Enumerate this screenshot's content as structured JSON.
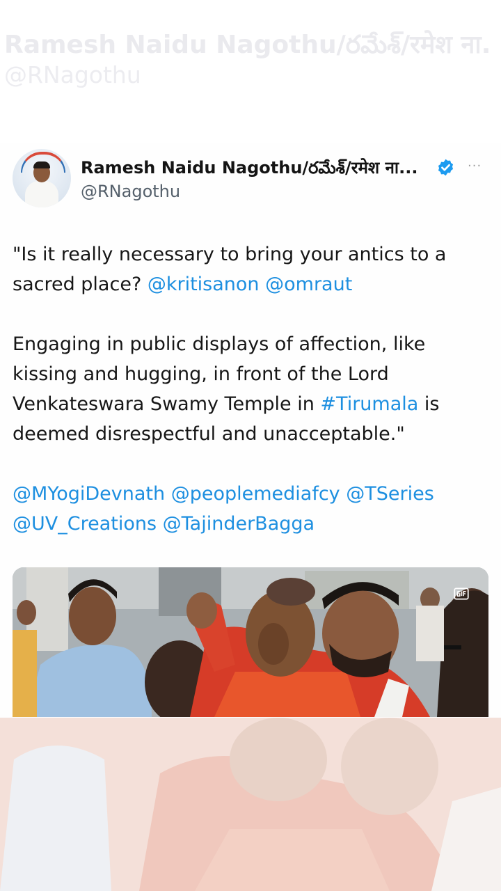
{
  "background": {
    "title": "Ramesh Naidu Nagothu/రమేశ్/रमेश ना.",
    "handle": "@RNagothu"
  },
  "post": {
    "display_name": "Ramesh Naidu Nagothu/రమేశ్/रमेश ना...",
    "handle": "@RNagothu",
    "more_label": "···",
    "verified": true,
    "accent_color": "#1d8fe0",
    "paragraph_1": {
      "quote": "\"Is it really necessary to bring your antics to a sacred place? ",
      "mention_1": "@kritisanon",
      "mention_2": "@omraut"
    },
    "paragraph_2": {
      "text_before": "Engaging in public displays of affection, like kissing and hugging, in front of the Lord Venkateswara Swamy Temple in ",
      "hashtag": "#Tirumala",
      "text_after": " is deemed disrespectful and unacceptable.\""
    },
    "paragraph_3": {
      "mention_1": "@MYogiDevnath",
      "mention_2": "@peoplemediafcy",
      "mention_3": "@TSeries",
      "mention_4": "@UV_Creations",
      "mention_5": "@TajinderBagga"
    },
    "media_icon": "gif-icon"
  }
}
